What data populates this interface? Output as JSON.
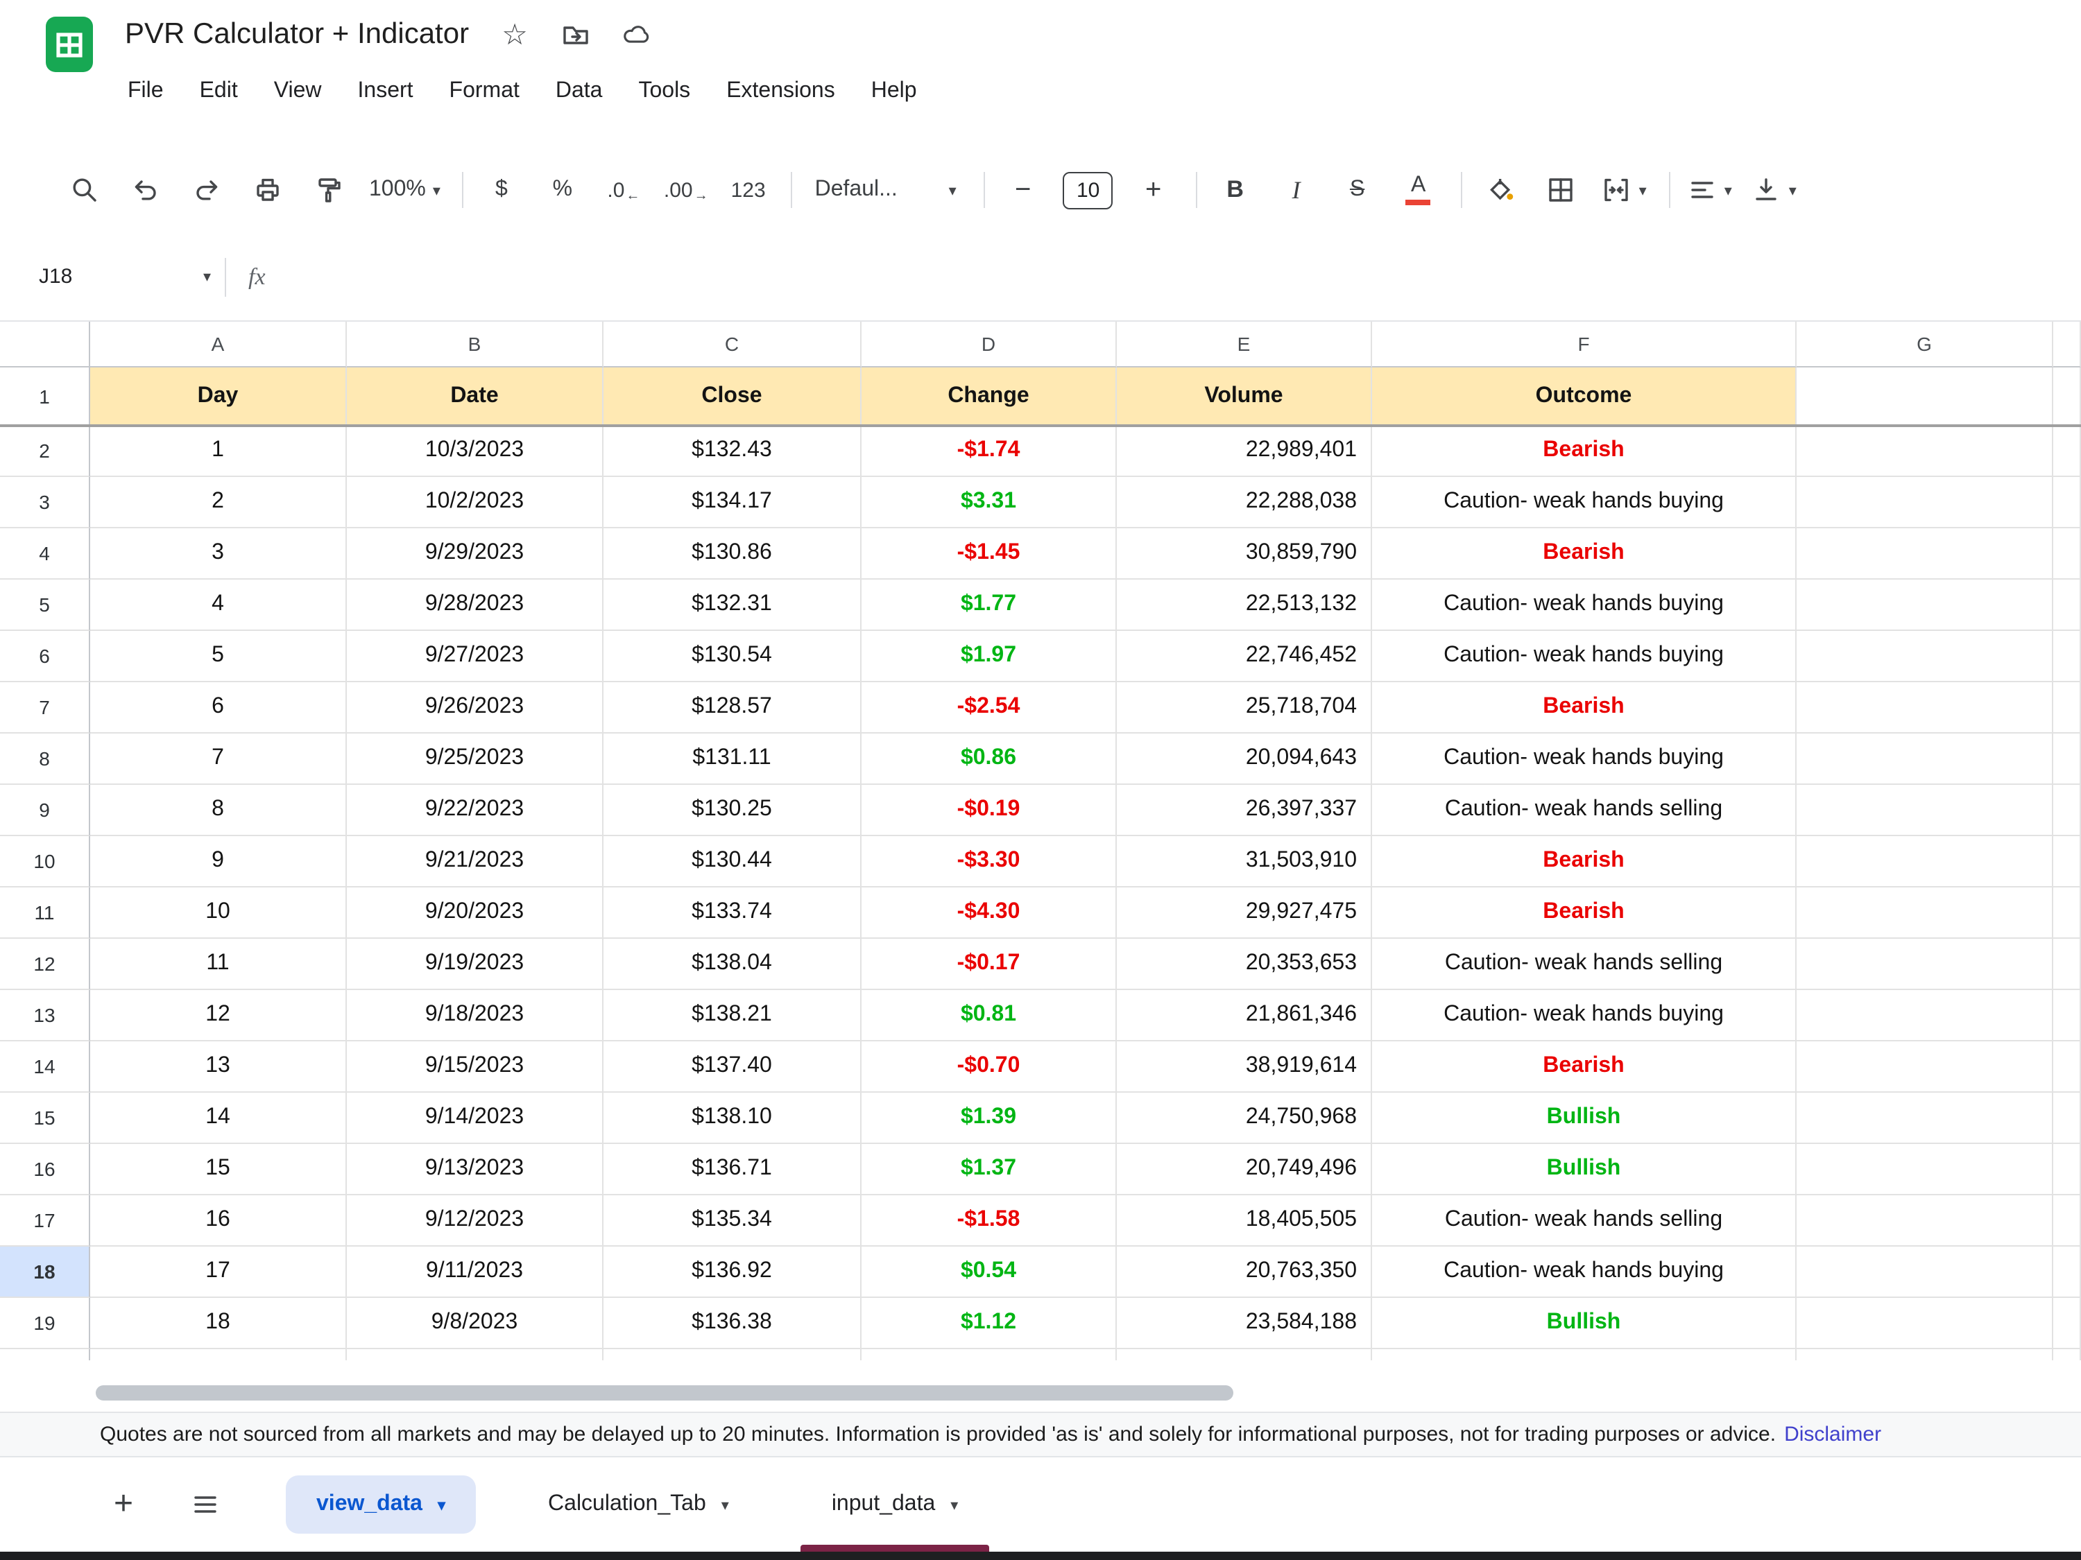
{
  "window": {
    "title": "PVR Calculator + Indicator",
    "menus": [
      "File",
      "Edit",
      "View",
      "Insert",
      "Format",
      "Data",
      "Tools",
      "Extensions",
      "Help"
    ]
  },
  "toolbar": {
    "zoom": "100%",
    "currency": "$",
    "percent": "%",
    "decrease_decimal": ".0",
    "increase_decimal": ".00",
    "number_format": "123",
    "font_family": "Defaul...",
    "font_size": "10",
    "bold": "B",
    "italic": "I",
    "strikethrough": "S",
    "text_color": "A"
  },
  "formula_bar": {
    "cell_reference": "J18",
    "fx_label": "fx"
  },
  "grid": {
    "column_letters": [
      "A",
      "B",
      "C",
      "D",
      "E",
      "F",
      "G"
    ],
    "first_row_number": "1",
    "headers": [
      "Day",
      "Date",
      "Close",
      "Change",
      "Volume",
      "Outcome"
    ],
    "selected_row": 18,
    "rows": [
      {
        "n": "2",
        "day": "1",
        "date": "10/3/2023",
        "close": "$132.43",
        "change": "-$1.74",
        "change_color": "neg",
        "volume": "22,989,401",
        "outcome": "Bearish",
        "outcome_style": "bearish"
      },
      {
        "n": "3",
        "day": "2",
        "date": "10/2/2023",
        "close": "$134.17",
        "change": "$3.31",
        "change_color": "pos",
        "volume": "22,288,038",
        "outcome": "Caution- weak hands buying",
        "outcome_style": "caution"
      },
      {
        "n": "4",
        "day": "3",
        "date": "9/29/2023",
        "close": "$130.86",
        "change": "-$1.45",
        "change_color": "neg",
        "volume": "30,859,790",
        "outcome": "Bearish",
        "outcome_style": "bearish"
      },
      {
        "n": "5",
        "day": "4",
        "date": "9/28/2023",
        "close": "$132.31",
        "change": "$1.77",
        "change_color": "pos",
        "volume": "22,513,132",
        "outcome": "Caution- weak hands buying",
        "outcome_style": "caution"
      },
      {
        "n": "6",
        "day": "5",
        "date": "9/27/2023",
        "close": "$130.54",
        "change": "$1.97",
        "change_color": "pos",
        "volume": "22,746,452",
        "outcome": "Caution- weak hands buying",
        "outcome_style": "caution"
      },
      {
        "n": "7",
        "day": "6",
        "date": "9/26/2023",
        "close": "$128.57",
        "change": "-$2.54",
        "change_color": "neg",
        "volume": "25,718,704",
        "outcome": "Bearish",
        "outcome_style": "bearish"
      },
      {
        "n": "8",
        "day": "7",
        "date": "9/25/2023",
        "close": "$131.11",
        "change": "$0.86",
        "change_color": "pos",
        "volume": "20,094,643",
        "outcome": "Caution- weak hands buying",
        "outcome_style": "caution"
      },
      {
        "n": "9",
        "day": "8",
        "date": "9/22/2023",
        "close": "$130.25",
        "change": "-$0.19",
        "change_color": "neg",
        "volume": "26,397,337",
        "outcome": "Caution- weak hands selling",
        "outcome_style": "caution"
      },
      {
        "n": "10",
        "day": "9",
        "date": "9/21/2023",
        "close": "$130.44",
        "change": "-$3.30",
        "change_color": "neg",
        "volume": "31,503,910",
        "outcome": "Bearish",
        "outcome_style": "bearish"
      },
      {
        "n": "11",
        "day": "10",
        "date": "9/20/2023",
        "close": "$133.74",
        "change": "-$4.30",
        "change_color": "neg",
        "volume": "29,927,475",
        "outcome": "Bearish",
        "outcome_style": "bearish"
      },
      {
        "n": "12",
        "day": "11",
        "date": "9/19/2023",
        "close": "$138.04",
        "change": "-$0.17",
        "change_color": "neg",
        "volume": "20,353,653",
        "outcome": "Caution- weak hands selling",
        "outcome_style": "caution"
      },
      {
        "n": "13",
        "day": "12",
        "date": "9/18/2023",
        "close": "$138.21",
        "change": "$0.81",
        "change_color": "pos",
        "volume": "21,861,346",
        "outcome": "Caution- weak hands buying",
        "outcome_style": "caution"
      },
      {
        "n": "14",
        "day": "13",
        "date": "9/15/2023",
        "close": "$137.40",
        "change": "-$0.70",
        "change_color": "neg",
        "volume": "38,919,614",
        "outcome": "Bearish",
        "outcome_style": "bearish"
      },
      {
        "n": "15",
        "day": "14",
        "date": "9/14/2023",
        "close": "$138.10",
        "change": "$1.39",
        "change_color": "pos",
        "volume": "24,750,968",
        "outcome": "Bullish",
        "outcome_style": "bullish"
      },
      {
        "n": "16",
        "day": "15",
        "date": "9/13/2023",
        "close": "$136.71",
        "change": "$1.37",
        "change_color": "pos",
        "volume": "20,749,496",
        "outcome": "Bullish",
        "outcome_style": "bullish"
      },
      {
        "n": "17",
        "day": "16",
        "date": "9/12/2023",
        "close": "$135.34",
        "change": "-$1.58",
        "change_color": "neg",
        "volume": "18,405,505",
        "outcome": "Caution- weak hands selling",
        "outcome_style": "caution"
      },
      {
        "n": "18",
        "day": "17",
        "date": "9/11/2023",
        "close": "$136.92",
        "change": "$0.54",
        "change_color": "pos",
        "volume": "20,763,350",
        "outcome": "Caution- weak hands buying",
        "outcome_style": "caution"
      },
      {
        "n": "19",
        "day": "18",
        "date": "9/8/2023",
        "close": "$136.38",
        "change": "$1.12",
        "change_color": "pos",
        "volume": "23,584,188",
        "outcome": "Bullish",
        "outcome_style": "bullish"
      }
    ]
  },
  "statusbar": {
    "disclaimer": "Quotes are not sourced from all markets and may be delayed up to 20 minutes. Information is provided 'as is' and solely for informational purposes, not for trading purposes or advice.",
    "disclaimer_link": "Disclaimer"
  },
  "tabs": {
    "items": [
      {
        "label": "view_data",
        "active": true
      },
      {
        "label": "Calculation_Tab",
        "active": false
      },
      {
        "label": "input_data",
        "active": false,
        "underline_color": "#7b2346"
      }
    ]
  },
  "colors": {
    "negative": "#ea0000",
    "positive": "#00b513",
    "header_row_bg": "#ffe9b3",
    "accent_blue": "#0b57d0",
    "active_tab_bg": "#dfe7f9",
    "selected_header_bg": "#d3e3fd",
    "link": "#4040cc",
    "text_color_underline": "#ea4335"
  }
}
